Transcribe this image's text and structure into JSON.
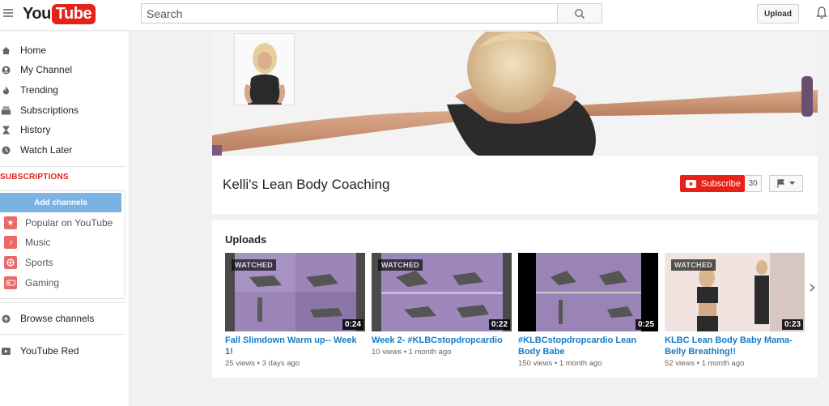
{
  "header": {
    "logo_you": "You",
    "logo_tube": "Tube",
    "search_placeholder": "Search",
    "upload_label": "Upload"
  },
  "sidebar": {
    "items": [
      {
        "label": "Home",
        "icon": "home-icon"
      },
      {
        "label": "My Channel",
        "icon": "user-icon"
      },
      {
        "label": "Trending",
        "icon": "flame-icon"
      },
      {
        "label": "Subscriptions",
        "icon": "subscriptions-icon"
      },
      {
        "label": "History",
        "icon": "hourglass-icon"
      },
      {
        "label": "Watch Later",
        "icon": "clock-icon"
      }
    ],
    "subscriptions_heading": "SUBSCRIPTIONS",
    "add_channels_label": "Add channels",
    "subscriptions": [
      {
        "label": "Popular on YouTube",
        "icon": "star-icon"
      },
      {
        "label": "Music",
        "icon": "music-icon"
      },
      {
        "label": "Sports",
        "icon": "sports-icon"
      },
      {
        "label": "Gaming",
        "icon": "gamepad-icon"
      }
    ],
    "browse_channels_label": "Browse channels",
    "youtube_red_label": "YouTube Red"
  },
  "channel": {
    "title": "Kelli's Lean Body Coaching",
    "subscribe_label": "Subscribe",
    "subscriber_count": "30"
  },
  "uploads": {
    "heading": "Uploads",
    "videos": [
      {
        "title": "Fall Slimdown Warm up-- Week 1!",
        "meta": "25 views • 3 days ago",
        "duration": "0:24",
        "watched": "WATCHED"
      },
      {
        "title": "Week 2- #KLBCstopdropcardio",
        "meta": "10 views • 1 month ago",
        "duration": "0:22",
        "watched": "WATCHED"
      },
      {
        "title": "#KLBCstopdropcardio Lean Body Babe",
        "meta": "150 views • 1 month ago",
        "duration": "0:25",
        "watched": ""
      },
      {
        "title": "KLBC Lean Body Baby Mama-Belly Breathing!!",
        "meta": "52 views • 1 month ago",
        "duration": "0:23",
        "watched": "WATCHED"
      }
    ]
  },
  "colors": {
    "brand_red": "#e62117",
    "link_blue": "#167ac6",
    "add_channels_blue": "#7ab2e3"
  }
}
